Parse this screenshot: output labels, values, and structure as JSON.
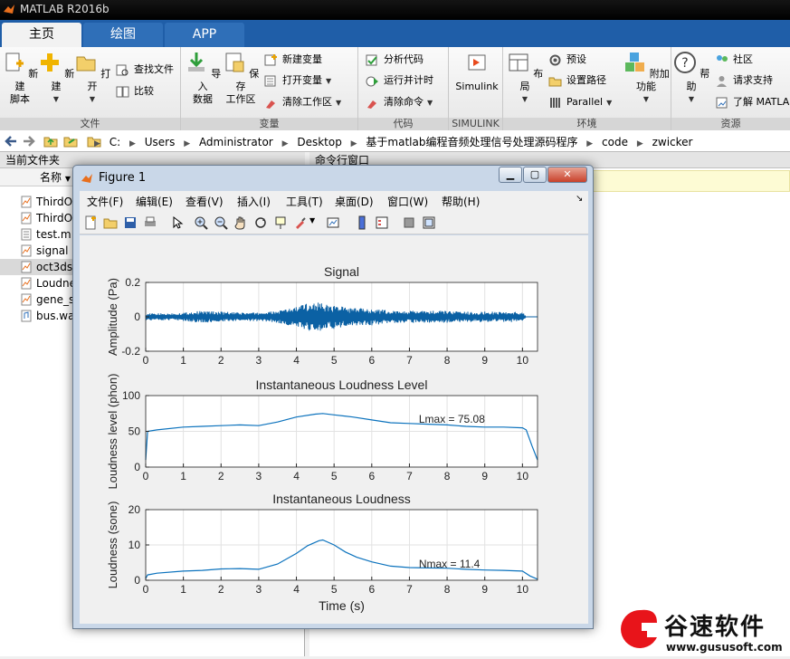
{
  "app": {
    "title": "MATLAB R2016b"
  },
  "tabs": [
    {
      "label": "主页",
      "active": true
    },
    {
      "label": "绘图",
      "active": false
    },
    {
      "label": "APP",
      "active": false
    }
  ],
  "ribbon": {
    "file_group": {
      "label": "文件",
      "new_script": "新建\n脚本",
      "new": "新建",
      "open": "打开",
      "find_files": "查找文件",
      "compare": "比较"
    },
    "variable_group": {
      "label": "变量",
      "import": "导入\n数据",
      "save_workspace": "保存\n工作区",
      "new_variable": "新建变量",
      "open_variable": "打开变量",
      "clear_workspace": "清除工作区"
    },
    "code_group": {
      "label": "代码",
      "analyze": "分析代码",
      "run_time": "运行并计时",
      "clear_commands": "清除命令"
    },
    "simulink_group": {
      "label": "SIMULINK",
      "simulink": "Simulink"
    },
    "env_group": {
      "label": "环境",
      "layout": "布局",
      "preferences": "预设",
      "set_path": "设置路径",
      "parallel": "Parallel",
      "addons": "附加功能"
    },
    "resources_group": {
      "label": "资源",
      "help": "帮助",
      "community": "社区",
      "support": "请求支持",
      "learn": "了解 MATLAB"
    }
  },
  "address": {
    "crumbs": [
      "C:",
      "Users",
      "Administrator",
      "Desktop",
      "基于matlab编程音频处理信号处理源码程序",
      "code",
      "zwicker"
    ]
  },
  "left_panel": {
    "title": "当前文件夹",
    "column_header": "名称",
    "files": [
      {
        "name": "ThirdO",
        "selected": false
      },
      {
        "name": "ThirdO",
        "selected": false
      },
      {
        "name": "test.m",
        "selected": false
      },
      {
        "name": "signal",
        "selected": false
      },
      {
        "name": "oct3ds",
        "selected": true
      },
      {
        "name": "Loudne",
        "selected": false
      },
      {
        "name": "gene_s",
        "selected": false
      },
      {
        "name": "bus.wa",
        "selected": false
      }
    ]
  },
  "command_panel": {
    "title": "命令行窗口"
  },
  "figure": {
    "title": "Figure 1",
    "menus": [
      "文件(F)",
      "编辑(E)",
      "查看(V)",
      "插入(I)",
      "工具(T)",
      "桌面(D)",
      "窗口(W)",
      "帮助(H)"
    ]
  },
  "chart_data": [
    {
      "type": "line",
      "title": "Signal",
      "xlabel": "",
      "ylabel": "Amplitude (Pa)",
      "xlim": [
        0,
        10.4
      ],
      "ylim": [
        -0.2,
        0.2
      ],
      "xticks": [
        0,
        1,
        2,
        3,
        4,
        5,
        6,
        7,
        8,
        9,
        10
      ],
      "yticks": [
        -0.2,
        0,
        0.2
      ],
      "envelope": {
        "x": [
          0,
          0.5,
          1,
          1.5,
          2,
          2.5,
          3,
          3.5,
          4,
          4.3,
          4.6,
          4.8,
          5,
          5.5,
          6,
          6.5,
          7,
          7.5,
          8,
          8.5,
          9,
          9.5,
          10,
          10.1
        ],
        "amp": [
          0.02,
          0.02,
          0.025,
          0.035,
          0.03,
          0.025,
          0.025,
          0.035,
          0.06,
          0.08,
          0.09,
          0.07,
          0.07,
          0.05,
          0.05,
          0.035,
          0.035,
          0.035,
          0.035,
          0.03,
          0.03,
          0.03,
          0.03,
          0.0
        ]
      },
      "grid": true
    },
    {
      "type": "line",
      "title": "Instantaneous Loudness Level",
      "xlabel": "",
      "ylabel": "Loudness level (phon)",
      "xlim": [
        0,
        10.4
      ],
      "ylim": [
        0,
        100
      ],
      "xticks": [
        0,
        1,
        2,
        3,
        4,
        5,
        6,
        7,
        8,
        9,
        10
      ],
      "yticks": [
        0,
        50,
        100
      ],
      "x": [
        0,
        0.05,
        0.3,
        1,
        1.5,
        2,
        2.5,
        3,
        3.5,
        4,
        4.5,
        4.7,
        5,
        5.5,
        6,
        6.5,
        7,
        7.5,
        8,
        8.5,
        9,
        9.5,
        10,
        10.1,
        10.25,
        10.4
      ],
      "values": [
        10,
        50,
        52,
        56,
        57,
        58,
        59,
        58,
        63,
        70,
        74,
        75,
        73,
        70,
        66,
        62,
        61,
        60,
        59,
        57,
        56,
        56,
        55,
        52,
        30,
        10
      ],
      "annotation": "Lmax = 75.08",
      "grid": true
    },
    {
      "type": "line",
      "title": "Instantaneous Loudness",
      "xlabel": "Time (s)",
      "ylabel": "Loudness (sone)",
      "xlim": [
        0,
        10.4
      ],
      "ylim": [
        0,
        20
      ],
      "xticks": [
        0,
        1,
        2,
        3,
        4,
        5,
        6,
        7,
        8,
        9,
        10
      ],
      "yticks": [
        0,
        10,
        20
      ],
      "x": [
        0,
        0.05,
        0.3,
        1,
        1.5,
        2,
        2.5,
        3,
        3.5,
        4,
        4.3,
        4.6,
        4.7,
        5,
        5.3,
        5.6,
        6,
        6.5,
        7,
        7.5,
        8,
        8.5,
        9,
        9.5,
        10,
        10.2,
        10.4
      ],
      "values": [
        0.5,
        1.5,
        2.0,
        2.6,
        2.8,
        3.2,
        3.3,
        3.1,
        4.6,
        7.6,
        9.8,
        11.2,
        11.4,
        10.0,
        8.0,
        6.5,
        5.2,
        4.0,
        3.6,
        3.5,
        3.4,
        3.1,
        2.9,
        2.8,
        2.6,
        1.2,
        0.3
      ],
      "annotation": "Nmax = 11.4",
      "grid": true
    }
  ],
  "watermark": {
    "brand": "谷速软件",
    "url": "www.gususoft.com"
  }
}
